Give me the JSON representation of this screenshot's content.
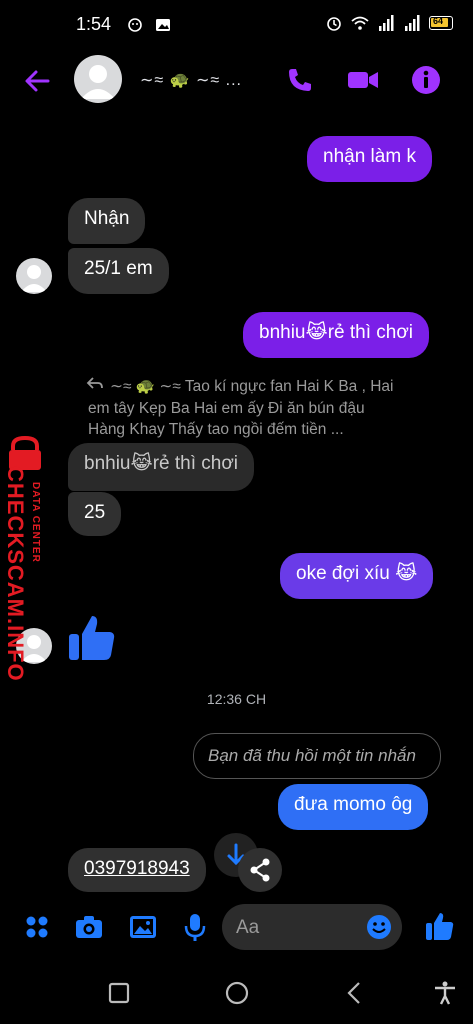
{
  "status_bar": {
    "time": "1:54",
    "battery": "64"
  },
  "header": {
    "contact_name": "∼≈ 🐢 ∼≈ ..."
  },
  "messages": {
    "m1": "nhận làm k",
    "m2": "Nhận",
    "m3": "25/1 em",
    "m4": "bnhiu😹rẻ thì chơi",
    "reply_context": "∼≈ 🐢 ∼≈ Tao kí ngực fan Hai K Ba , Hai em tây Kẹp Ba Hai em ấy Đi ăn bún đậu Hàng Khay Thấy tao ngồi đếm tiền ...",
    "m5": "bnhiu😹rẻ thì chơi",
    "m6": "25",
    "m7": "oke đợi xíu 😹",
    "timestamp": "12:36 CH",
    "unsent": "Bạn đã thu hồi một tin nhắn",
    "m8": "đưa momo ôg",
    "m9": "0397918943"
  },
  "watermark": {
    "main": "CHECKSCAM.INFO",
    "sub": "DATA CENTER"
  },
  "composer": {
    "placeholder": "Aa"
  },
  "colors": {
    "accent": "#a033ff",
    "outgoing": "#7b1fe8",
    "outgoing_blue": "#2f6ff5",
    "composer_blue": "#1f7bff",
    "watermark_red": "#e31b23"
  },
  "icons": {
    "back": "back-arrow-icon",
    "call": "phone-icon",
    "video": "video-camera-icon",
    "info": "info-icon",
    "like": "thumbs-up-icon",
    "menu": "four-dots-icon",
    "camera": "camera-icon",
    "gallery": "image-icon",
    "mic": "microphone-icon",
    "emoji": "emoji-icon",
    "scroll_down": "arrow-down-icon",
    "share": "share-icon"
  }
}
